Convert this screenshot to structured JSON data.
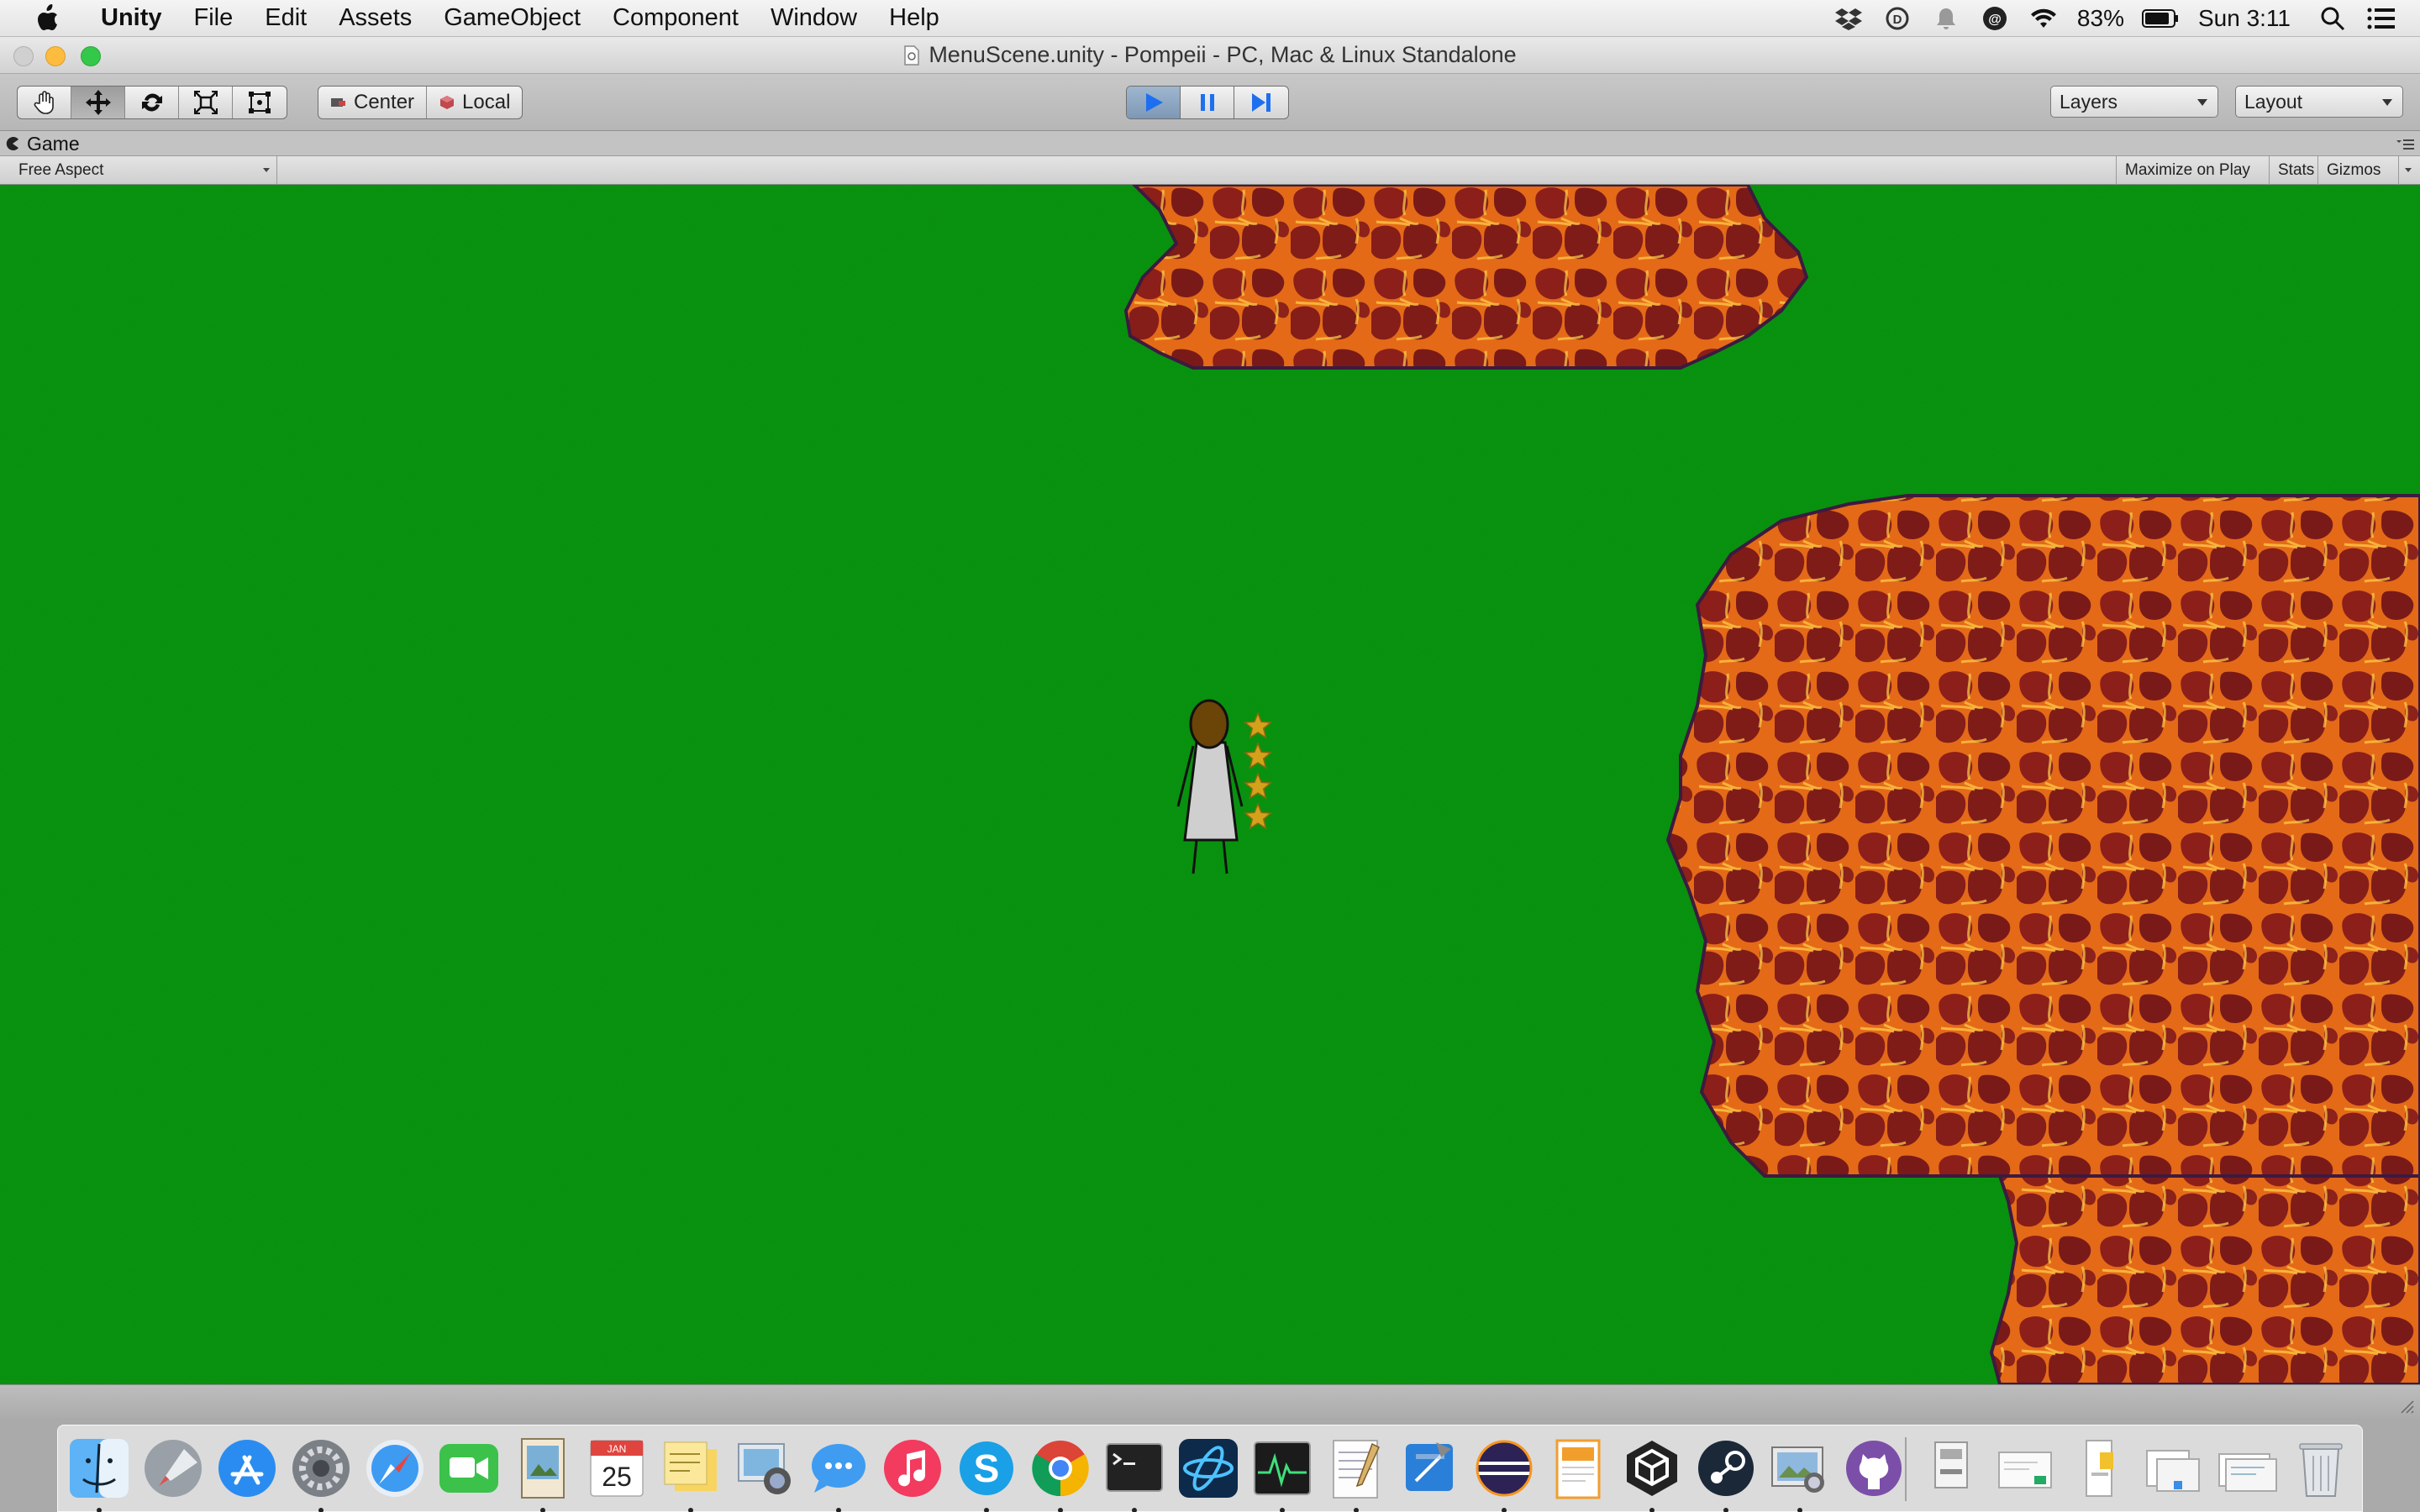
{
  "menubar": {
    "app_name": "Unity",
    "items": [
      "File",
      "Edit",
      "Assets",
      "GameObject",
      "Component",
      "Window",
      "Help"
    ],
    "battery": "83%",
    "clock": "Sun 3:11"
  },
  "window": {
    "title": "MenuScene.unity - Pompeii - PC, Mac & Linux Standalone"
  },
  "toolbar": {
    "pivot_label": "Center",
    "space_label": "Local",
    "layers_label": "Layers",
    "layout_label": "Layout"
  },
  "game_panel": {
    "tab_label": "Game",
    "aspect_label": "Free Aspect",
    "maximize_label": "Maximize on Play",
    "stats_label": "Stats",
    "gizmos_label": "Gizmos"
  },
  "game_view": {
    "background_color": "#0a8a12",
    "lava_color": "#b23a10",
    "player_health_stars": 4
  },
  "dock": {
    "apps": [
      "Finder",
      "Launchpad",
      "App Store",
      "System Preferences",
      "Safari",
      "FaceTime",
      "Preview",
      "Calendar",
      "Stickies",
      "Image Capture",
      "Messages",
      "iTunes",
      "Skype",
      "Chrome",
      "Terminal",
      "Battle.net",
      "Activity Monitor",
      "TextEdit",
      "Xcode",
      "Eclipse",
      "Pages",
      "Unity",
      "Steam",
      "Photo Viewer",
      "GitHub"
    ],
    "calendar_month": "JAN",
    "calendar_day": "25"
  }
}
